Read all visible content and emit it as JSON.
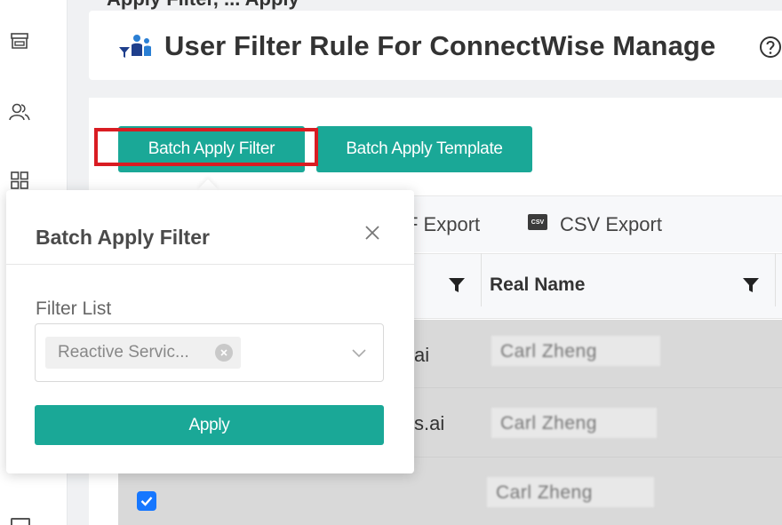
{
  "page": {
    "title": "User Filter Rule For ConnectWise Manage",
    "top_clipped_text": "Apply Filter, ... Apply"
  },
  "sidebar": {
    "icons": [
      "store-icon",
      "users-icon",
      "grid-icon"
    ]
  },
  "actions": {
    "batch_apply_filter": "Batch Apply Filter",
    "batch_apply_template": "Batch Apply Template"
  },
  "toolbar": {
    "pdf_export": "F Export",
    "csv_icon_text": "CSV",
    "csv_export": "CSV Export"
  },
  "table": {
    "columns": [
      {
        "label": ""
      },
      {
        "label": "Real Name"
      }
    ],
    "rows": [
      {
        "tail": "ai",
        "real_name": "Carl Zheng"
      },
      {
        "tail": "s.ai",
        "real_name": "Carl Zheng"
      },
      {
        "tail": "",
        "real_name": "Carl Zheng",
        "checked": true
      }
    ]
  },
  "popup": {
    "title": "Batch Apply Filter",
    "field_label": "Filter List",
    "selected_tag": "Reactive Servic...",
    "apply_label": "Apply"
  },
  "colors": {
    "accent": "#1aa897",
    "highlight": "#d91c22",
    "checkbox": "#1677ff"
  }
}
